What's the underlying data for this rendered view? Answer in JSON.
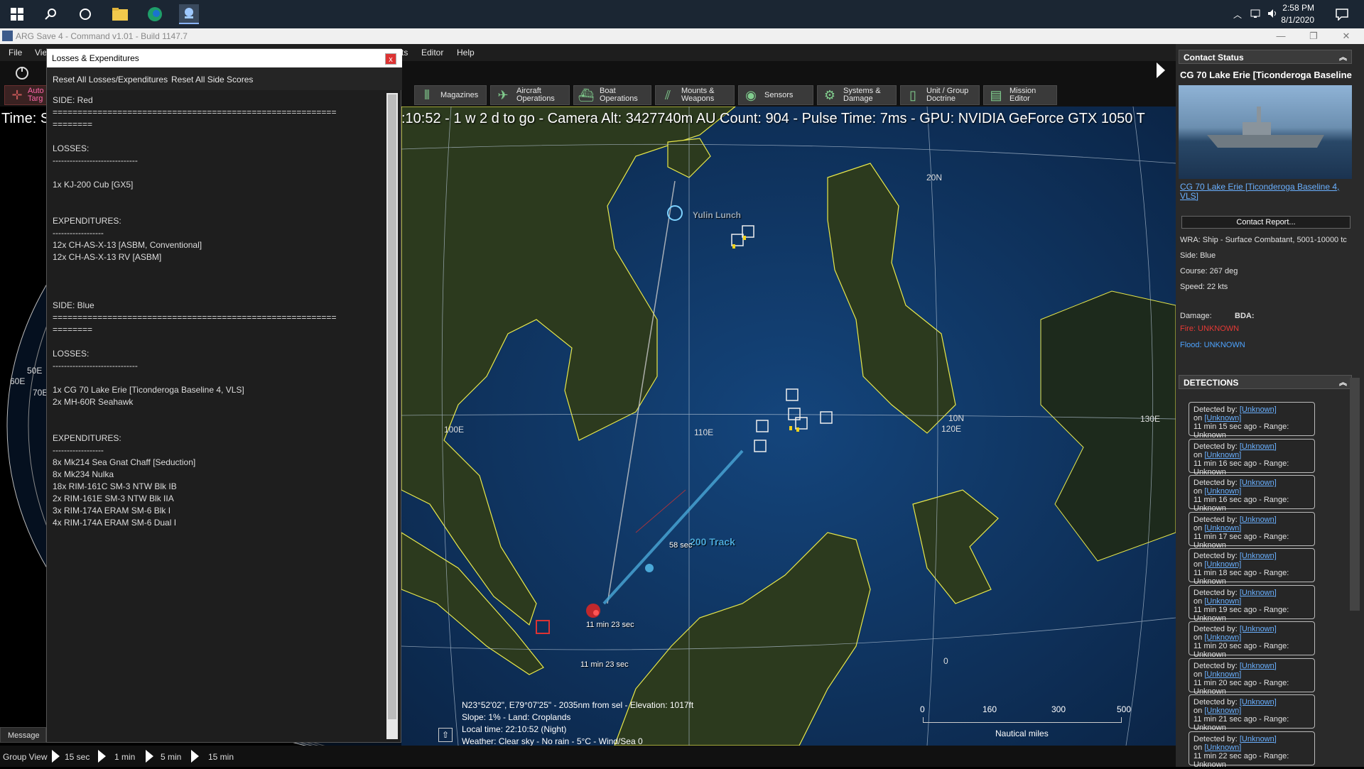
{
  "taskbar": {
    "time": "2:58 PM",
    "date": "8/1/2020"
  },
  "window": {
    "title": "ARG Save 4 - Command v1.01 - Build 1147.7"
  },
  "menu": {
    "file": "File",
    "view": "Vie",
    "scenario": "ts",
    "editor": "Editor",
    "help": "Help"
  },
  "toolbar": {
    "auto_target": "Auto\nTarg",
    "magazines": "Magazines",
    "aircraft_ops": "Aircraft\nOperations",
    "boat_ops": "Boat\nOperations",
    "mounts": "Mounts &\nWeapons",
    "sensors": "Sensors",
    "systems": "Systems &\nDamage",
    "unit_doctrine": "Unit / Group\nDoctrine",
    "mission_editor": "Mission\nEditor"
  },
  "status_line": ":10:52 - 1 w 2 d to go -  Camera Alt: 3427740m  AU Count: 904 - Pulse Time: 7ms - GPU: NVIDIA GeForce GTX 1050 T",
  "time_left": "Time: S",
  "losses_window": {
    "title": "Losses & Expenditures",
    "close": "x",
    "reset_losses": "Reset All Losses/Expenditures",
    "reset_scores": "Reset All Side Scores",
    "body": "SIDE: Red\n=========================================================\n========\n\nLOSSES:\n------------------------------\n\n1x KJ-200 Cub [GX5]\n\n\nEXPENDITURES:\n------------------\n12x CH-AS-X-13 [ASBM, Conventional]\n12x CH-AS-X-13 RV [ASBM]\n\n\n\nSIDE: Blue\n=========================================================\n========\n\nLOSSES:\n------------------------------\n\n1x CG 70 Lake Erie [Ticonderoga Baseline 4, VLS]\n2x MH-60R Seahawk\n\n\nEXPENDITURES:\n------------------\n8x Mk214 Sea Gnat Chaff [Seduction]\n8x Mk234 Nulka\n18x RIM-161C SM-3 NTW Blk IB\n2x RIM-161E SM-3 NTW Blk IIA\n3x RIM-174A ERAM SM-6 Blk I\n4x RIM-174A ERAM SM-6 Dual I"
  },
  "contact_status": {
    "header": "Contact Status",
    "name": "CG 70 Lake Erie [Ticonderoga Baseline",
    "link": "CG 70 Lake Erie [Ticonderoga Baseline 4, VLS]",
    "report_button": "Contact Report...",
    "wra": "WRA: Ship - Surface Combatant, 5001-10000 tc",
    "side": "Side: Blue",
    "course": "Course: 267 deg",
    "speed": "Speed: 22 kts",
    "damage": "Damage:",
    "bda": "BDA:",
    "fire": "Fire: UNKNOWN",
    "flood": "Flood: UNKNOWN"
  },
  "detections": {
    "header": "DETECTIONS",
    "detected_by": "Detected by:",
    "unknown": "[Unknown]",
    "on": "on",
    "items": [
      {
        "ago": "11 min 15 sec ago",
        "range": "- Range: Unknown"
      },
      {
        "ago": "11 min 16 sec ago",
        "range": "- Range: Unknown"
      },
      {
        "ago": "11 min 16 sec ago",
        "range": "- Range: Unknown"
      },
      {
        "ago": "11 min 17 sec ago",
        "range": "- Range: Unknown"
      },
      {
        "ago": "11 min 18 sec ago",
        "range": "- Range: Unknown"
      },
      {
        "ago": "11 min 19 sec ago",
        "range": "- Range: Unknown"
      },
      {
        "ago": "11 min 20 sec ago",
        "range": "- Range: Unknown"
      },
      {
        "ago": "11 min 20 sec ago",
        "range": "- Range: Unknown"
      },
      {
        "ago": "11 min 21 sec ago",
        "range": "- Range: Unknown"
      },
      {
        "ago": "11 min 22 sec ago",
        "range": "- Range: Unknown"
      }
    ]
  },
  "map": {
    "grid_20n": "20N",
    "grid_10n": "10N",
    "grid_100e": "100E",
    "grid_110e": "110E",
    "grid_120e": "120E",
    "grid_130e": "130E",
    "grid_0": "0",
    "grid_50e": "50E",
    "grid_60e": "60E",
    "grid_70e": "70E",
    "label_yulin": "Yulin Lunch",
    "label_track": "200 Track",
    "label_58sec": "58 sec",
    "label_11min23": "11 min 23 sec",
    "label_overlap": "11 min 23 sec",
    "info": "N23°52'02\", E79°07'25\" - 2035nm from sel - Elevation: 1017ft\nSlope: 1% - Land: Croplands\nLocal time: 22:10:52 (Night)\nWeather: Clear sky - No rain - 5°C - Wind/Sea 0",
    "scale_0": "0",
    "scale_160": "160",
    "scale_300": "300",
    "scale_500": "500",
    "scale_unit": "Nautical miles"
  },
  "bottom": {
    "message": "Message L",
    "group_view": "Group View",
    "t15s": "15 sec",
    "t1m": "1 min",
    "t5m": "5 min",
    "t15m": "15 min"
  },
  "colors": {
    "coast": "#e8e84a",
    "ocean": "#123a6b",
    "land": "#2c3a1e",
    "link": "#6ab0ff",
    "fire": "#e53935",
    "flood": "#4da3ff"
  }
}
